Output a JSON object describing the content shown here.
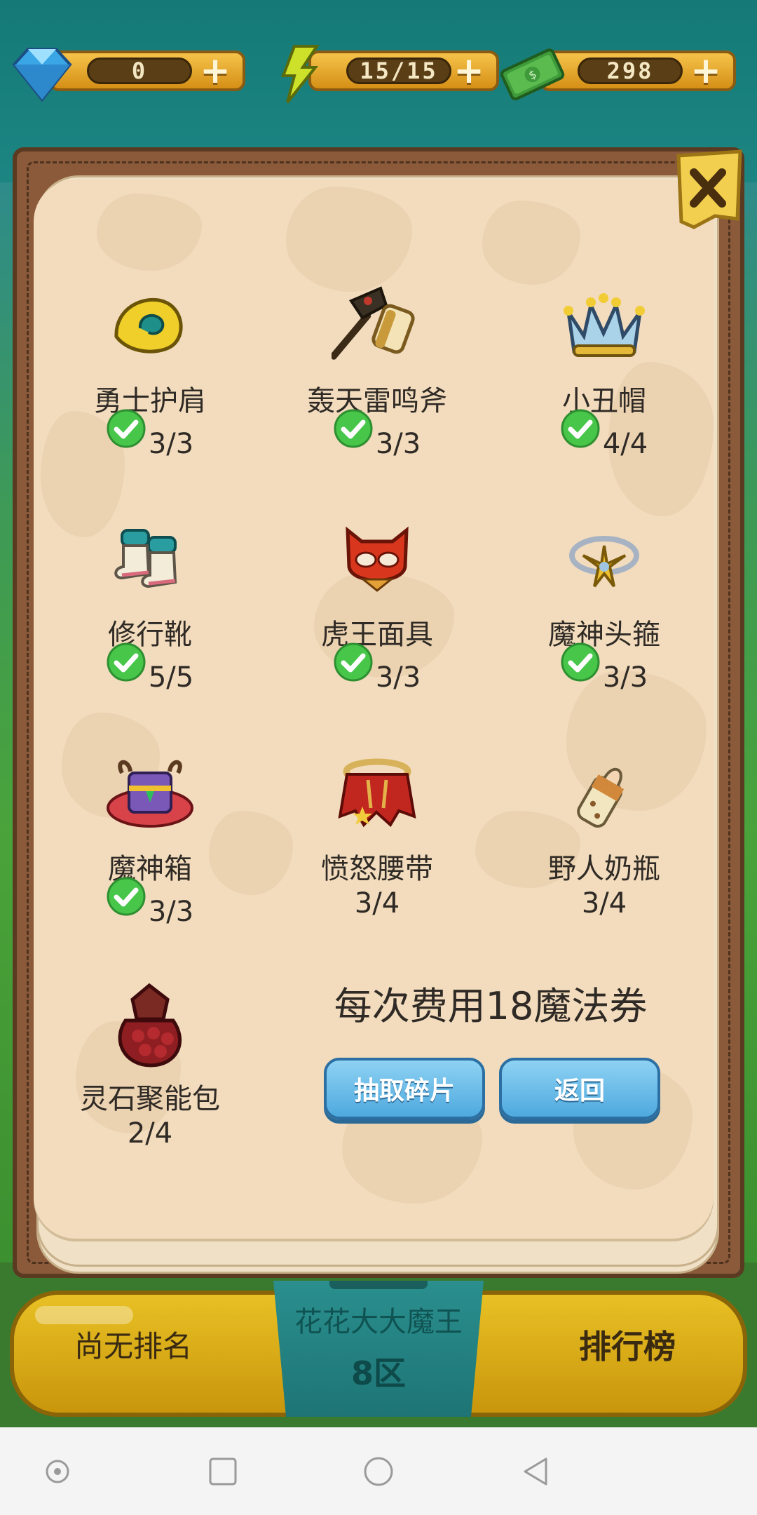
{
  "currencies": [
    {
      "name": "diamond",
      "value": "0",
      "icon": "diamond-icon"
    },
    {
      "name": "energy",
      "value": "15/15",
      "icon": "lightning-icon"
    },
    {
      "name": "cash",
      "value": "298",
      "icon": "cash-icon"
    }
  ],
  "items": [
    {
      "name": "勇士护肩",
      "count": "3/3",
      "complete": true,
      "icon": "shoulder-pad-icon"
    },
    {
      "name": "轰天雷鸣斧",
      "count": "3/3",
      "complete": true,
      "icon": "thunder-axe-icon"
    },
    {
      "name": "小丑帽",
      "count": "4/4",
      "complete": true,
      "icon": "crown-icon"
    },
    {
      "name": "修行靴",
      "count": "5/5",
      "complete": true,
      "icon": "boots-icon"
    },
    {
      "name": "虎王面具",
      "count": "3/3",
      "complete": true,
      "icon": "tiger-mask-icon"
    },
    {
      "name": "魔神头箍",
      "count": "3/3",
      "complete": true,
      "icon": "circlet-icon"
    },
    {
      "name": "魔神箱",
      "count": "3/3",
      "complete": true,
      "icon": "chest-icon"
    },
    {
      "name": "愤怒腰带",
      "count": "3/4",
      "complete": false,
      "icon": "belt-icon"
    },
    {
      "name": "野人奶瓶",
      "count": "3/4",
      "complete": false,
      "icon": "baby-bottle-icon"
    },
    {
      "name": "灵石聚能包",
      "count": "2/4",
      "complete": false,
      "icon": "stone-pouch-icon"
    }
  ],
  "cost_text": "每次费用18魔法券",
  "buttons": {
    "draw": "抽取碎片",
    "back": "返回"
  },
  "bottom_bar": {
    "rank": "尚无排名",
    "server_name": "花花大大魔王",
    "server_zone": "8区",
    "leaderboard": "排行榜"
  },
  "colors": {
    "accent_blue": "#5fb6e6",
    "gold": "#e2b51d",
    "panel_paper": "#f2dcbd",
    "check_green": "#47c64a"
  }
}
